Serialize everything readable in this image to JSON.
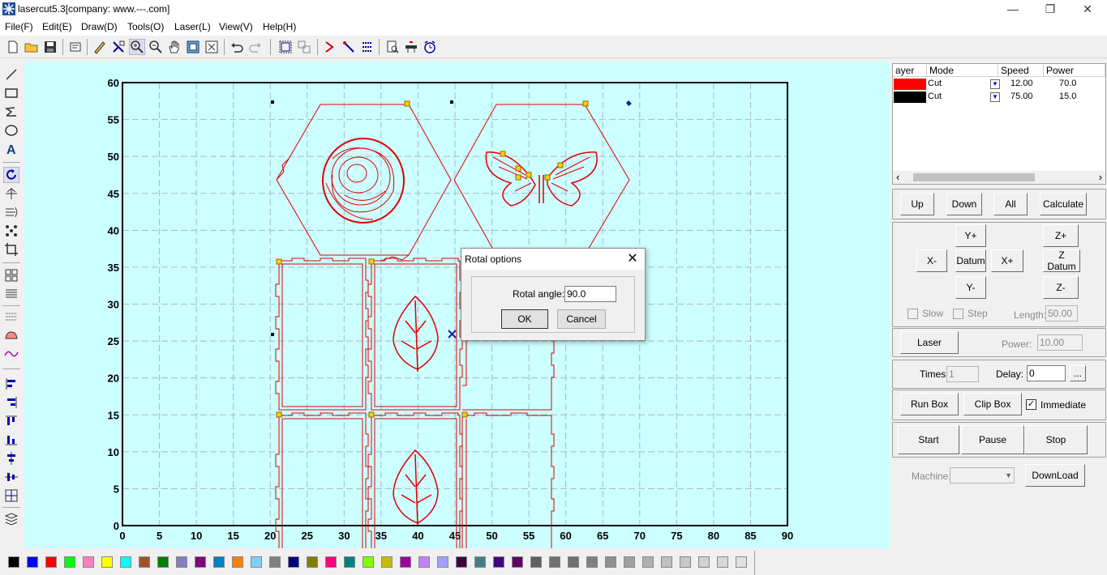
{
  "window": {
    "title": "lasercut5.3[company: www.---.com]",
    "minimize": "—",
    "maximize": "❐",
    "close": "✕"
  },
  "menu": [
    "File(F)",
    "Edit(E)",
    "Draw(D)",
    "Tools(O)",
    "Laser(L)",
    "View(V)",
    "Help(H)"
  ],
  "canvas": {
    "x_ticks": [
      "0",
      "5",
      "10",
      "15",
      "20",
      "25",
      "30",
      "35",
      "40",
      "45",
      "50",
      "55",
      "60",
      "65",
      "70",
      "75",
      "80",
      "85",
      "90"
    ],
    "y_ticks": [
      "60",
      "55",
      "50",
      "45",
      "40",
      "35",
      "30",
      "25",
      "20",
      "15",
      "10",
      "5",
      "0"
    ],
    "x_range": [
      0,
      90
    ],
    "y_range": [
      0,
      60
    ]
  },
  "layers": {
    "headers": [
      "ayer",
      "Mode",
      "Speed",
      "Power"
    ],
    "rows": [
      {
        "color": "#ff0000",
        "mode": "Cut",
        "speed": "12.00",
        "power": "70.0"
      },
      {
        "color": "#000000",
        "mode": "Cut",
        "speed": "75.00",
        "power": "15.0"
      }
    ],
    "scroll_left": "‹",
    "scroll_right": "›"
  },
  "layer_buttons": {
    "up": "Up",
    "down": "Down",
    "all": "All",
    "calculate": "Calculate"
  },
  "move": {
    "y_plus": "Y+",
    "y_minus": "Y-",
    "x_minus": "X-",
    "x_plus": "X+",
    "datum": "Datum",
    "z_plus": "Z+",
    "z_datum": "Z Datum",
    "z_minus": "Z-",
    "slow": "Slow",
    "step": "Step",
    "length_label": "Length:",
    "length_value": "50.00"
  },
  "laser": {
    "button": "Laser",
    "power_label": "Power:",
    "power_value": "10.00"
  },
  "timing": {
    "times_label": "Times:",
    "times_value": "1",
    "delay_label": "Delay:",
    "delay_value": "0",
    "more": "..."
  },
  "boxes": {
    "run_box": "Run Box",
    "clip_box": "Clip Box",
    "immediate": "Immediate",
    "immediate_checked": "✓"
  },
  "control": {
    "start": "Start",
    "pause": "Pause",
    "stop": "Stop"
  },
  "machine": {
    "label": "Machine:",
    "value": "",
    "download": "DownLoad"
  },
  "dialog": {
    "title": "Rotal options",
    "close": "✕",
    "angle_label": "Rotal angle:",
    "angle_value": "90.0",
    "ok": "OK",
    "cancel": "Cancel"
  },
  "palette": [
    "#000000",
    "#0000ff",
    "#ff0000",
    "#00ff00",
    "#ff80c0",
    "#ffff00",
    "#00ffff",
    "#a0522d",
    "#008000",
    "#8080c0",
    "#800080",
    "#0080c0",
    "#ff8000",
    "#80d0ff",
    "#808080",
    "#000080",
    "#808000",
    "#ff0080",
    "#008080",
    "#80ff00",
    "#c0c000",
    "#a000a0",
    "#c080ff",
    "#a0a0ff",
    "#400040",
    "#408080",
    "#400080",
    "#600060",
    "#606060",
    "#707070",
    "#707070",
    "#808080",
    "#909090",
    "#a0a0a0",
    "#b0b0b0",
    "#c0c0c0",
    "#c8c8c8",
    "#d0d0d0",
    "#d8d8d8",
    "#e0e0e0"
  ]
}
